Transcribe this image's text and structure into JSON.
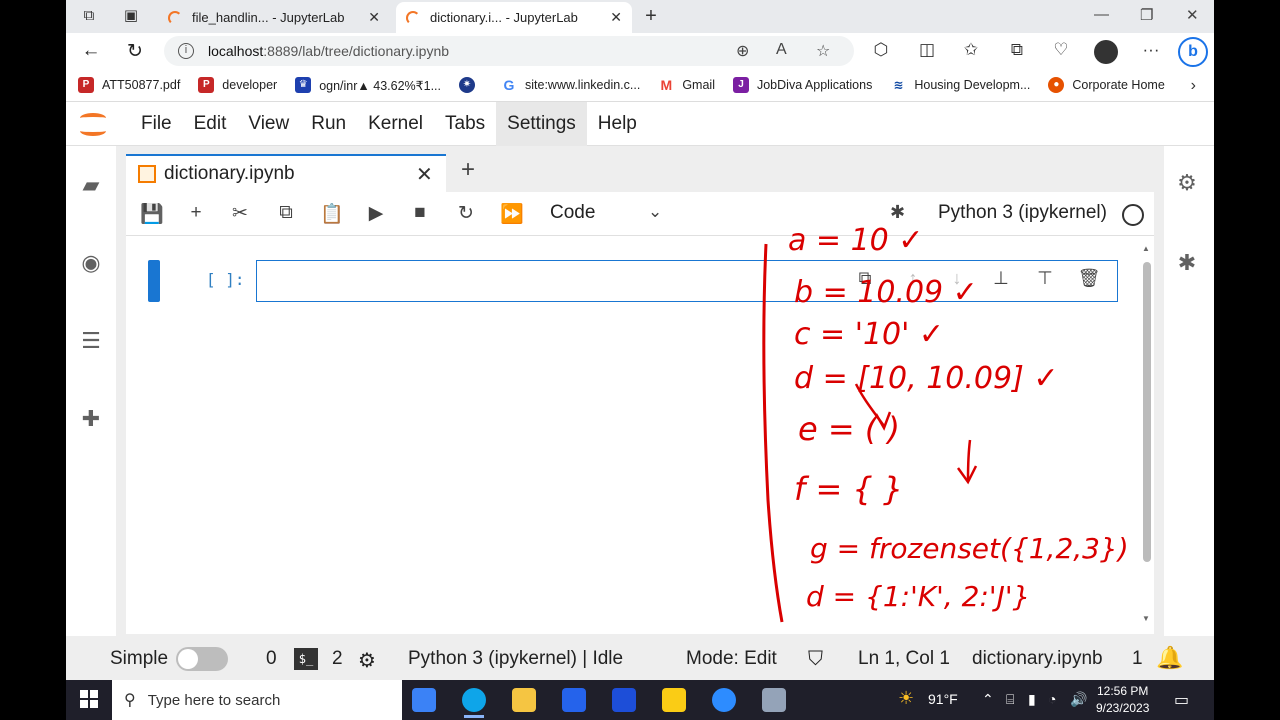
{
  "browser": {
    "tabs": [
      {
        "title": "file_handlin... - JupyterLab",
        "active": false
      },
      {
        "title": "dictionary.i... - JupyterLab",
        "active": true
      }
    ],
    "url_host": "localhost",
    "url_path": ":8889/lab/tree/dictionary.ipynb",
    "bookmarks": [
      {
        "label": "ATT50877.pdf",
        "icon": "pdf-icon",
        "color": "#c62828"
      },
      {
        "label": "developer",
        "icon": "pdf-icon",
        "color": "#c62828"
      },
      {
        "label": "ogn/inr▲ 43.62%₹1...",
        "icon": "crown-icon",
        "color": "#1e40af"
      },
      {
        "label": "",
        "icon": "police-badge-icon",
        "color": "#1e3a8a"
      },
      {
        "label": "site:www.linkedin.c...",
        "icon": "google-icon",
        "color": "#4285f4"
      },
      {
        "label": "Gmail",
        "icon": "gmail-icon",
        "color": "#ea4335"
      },
      {
        "label": "JobDiva Applications",
        "icon": "jobdiva-icon",
        "color": "#7b1fa2"
      },
      {
        "label": "Housing Developm...",
        "icon": "hud-icon",
        "color": "#0d47a1"
      },
      {
        "label": "Corporate Home",
        "icon": "corporate-icon",
        "color": "#e65100"
      }
    ]
  },
  "jupyter": {
    "menu": [
      "File",
      "Edit",
      "View",
      "Run",
      "Kernel",
      "Tabs",
      "Settings",
      "Help"
    ],
    "highlighted_menu": "Settings",
    "doc_tab": "dictionary.ipynb",
    "cell_type": "Code",
    "kernel": "Python 3 (ipykernel)",
    "cell_prompt": "[ ]:",
    "cell_value": ""
  },
  "status": {
    "mode_label": "Simple",
    "terminals_count": "0",
    "terminal_icon_text": "$_",
    "kernels_count": "2",
    "kernel_status": "Python 3 (ipykernel) | Idle",
    "mode": "Mode: Edit",
    "cursor": "Ln 1, Col 1",
    "filename": "dictionary.ipynb",
    "notifications": "1"
  },
  "annotations": {
    "lines": [
      "a = 10 ✓",
      "b = 10.09 ✓",
      "c = '10' ✓",
      "d = [10, 10.09] ✓",
      "e = ( )",
      "f = { }",
      "g = frozenset({1,2,3})",
      "d = {1:'K', 2:'J'}"
    ],
    "color": "#d90000"
  },
  "taskbar": {
    "search_placeholder": "Type here to search",
    "weather": "91°F",
    "time": "12:56 PM",
    "date": "9/23/2023"
  },
  "colors": {
    "accent": "#1976d2",
    "jupyter_orange": "#f37626",
    "annotation_red": "#d90000"
  }
}
